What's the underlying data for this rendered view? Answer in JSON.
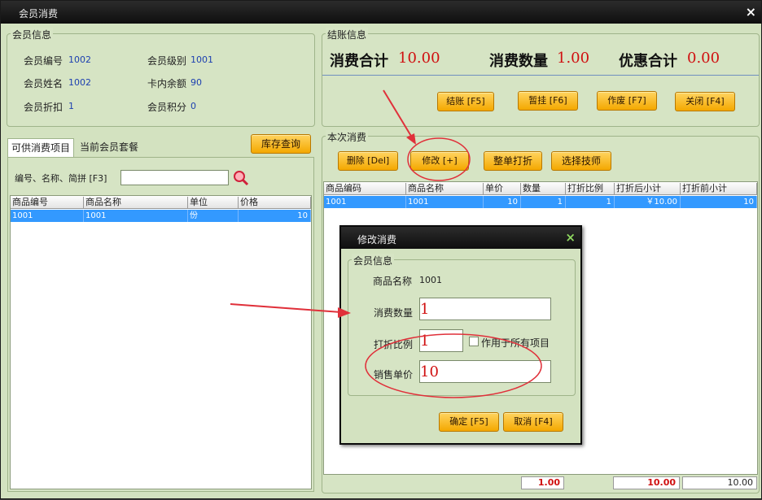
{
  "window": {
    "title": "会员消费",
    "close_icon": "×"
  },
  "member": {
    "group_title": "会员信息",
    "fields": [
      {
        "label": "会员编号",
        "value": "1002"
      },
      {
        "label": "会员级别",
        "value": "1001"
      },
      {
        "label": "会员姓名",
        "value": "1002"
      },
      {
        "label": "卡内余额",
        "value": "90"
      },
      {
        "label": "会员折扣",
        "value": "1"
      },
      {
        "label": "会员积分",
        "value": "0"
      }
    ]
  },
  "checkout": {
    "group_title": "结账信息",
    "total_label": "消费合计",
    "total_value": "10.00",
    "qty_label": "消费数量",
    "qty_value": "1.00",
    "discount_label": "优惠合计",
    "discount_value": "0.00",
    "buttons": [
      "结账 [F5]",
      "暂挂 [F6]",
      "作废 [F7]",
      "关闭 [F4]"
    ]
  },
  "products": {
    "tabs": [
      "可供消费项目",
      "当前会员套餐"
    ],
    "stock_button": "库存查询",
    "search_label": "编号、名称、简拼 [F3]",
    "search_value": "",
    "columns": [
      "商品编号",
      "商品名称",
      "单位",
      "价格"
    ],
    "rows": [
      [
        "1001",
        "1001",
        "份",
        "10"
      ]
    ]
  },
  "current": {
    "group_title": "本次消费",
    "buttons": [
      "删除 [Del]",
      "修改 [+]",
      "整单打折",
      "选择技师"
    ],
    "columns": [
      "商品编码",
      "商品名称",
      "单价",
      "数量",
      "打折比例",
      "打折后小计",
      "打折前小计"
    ],
    "rows": [
      [
        "1001",
        "1001",
        "10",
        "1",
        "1",
        "￥10.00",
        "10"
      ]
    ],
    "footer": [
      "1.00",
      "10.00",
      "10.00"
    ]
  },
  "dialog": {
    "title": "修改消费",
    "close_icon": "×",
    "group_title": "会员信息",
    "product_label": "商品名称",
    "product_value": "1001",
    "qty_label": "消费数量",
    "qty_value": "1",
    "discount_label": "打折比例",
    "discount_value": "1",
    "apply_all_label": "作用于所有项目",
    "price_label": "销售单价",
    "price_value": "10",
    "ok_button": "确定 [F5]",
    "cancel_button": "取消 [F4]"
  },
  "colors": {
    "accent_red": "#d01010",
    "selection": "#3399ff",
    "button": "#f4a800",
    "annotation": "#e0303a"
  }
}
